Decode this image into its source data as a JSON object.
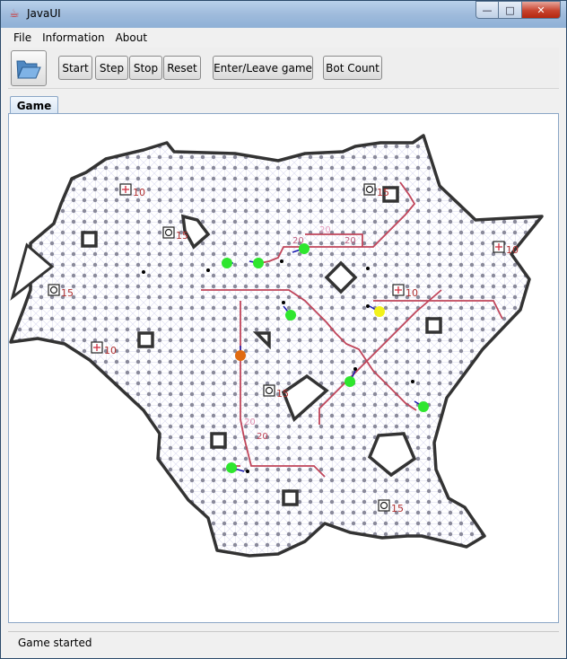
{
  "window": {
    "title": "JavaUI"
  },
  "menu": [
    {
      "label": "File"
    },
    {
      "label": "Information"
    },
    {
      "label": "About"
    }
  ],
  "toolbar": {
    "open_icon": "folder-open-icon",
    "buttons": [
      {
        "id": "start",
        "label": "Start"
      },
      {
        "id": "step",
        "label": "Step"
      },
      {
        "id": "stop",
        "label": "Stop"
      },
      {
        "id": "reset",
        "label": "Reset"
      },
      {
        "id": "enter-leave-game",
        "label": "Enter/Leave game"
      },
      {
        "id": "bot-count",
        "label": "Bot Count"
      }
    ]
  },
  "tabs": [
    {
      "label": "Game",
      "selected": true
    }
  ],
  "game": {
    "items": [
      {
        "kind": "plus",
        "label": "10"
      },
      {
        "kind": "ring",
        "label": "15"
      },
      {
        "kind": "ring",
        "label": "15"
      },
      {
        "kind": "plus",
        "label": "10"
      },
      {
        "kind": "ring",
        "label": "15"
      },
      {
        "kind": "plus",
        "label": "10"
      },
      {
        "kind": "plus",
        "label": "10"
      },
      {
        "kind": "ring",
        "label": "15"
      },
      {
        "kind": "ring",
        "label": "15"
      }
    ],
    "path_labels": [
      "20",
      "20",
      "20",
      "20",
      "20"
    ],
    "colors": {
      "wall": "#333333",
      "grid_line": "#c5c5e6",
      "grid_node": "#8a8a9a",
      "path": "#c0455a",
      "bot": "#2ee62e",
      "bot_self": "#f2f21a",
      "bot_enemy": "#e06a10"
    }
  },
  "status": {
    "text": "Game started"
  }
}
